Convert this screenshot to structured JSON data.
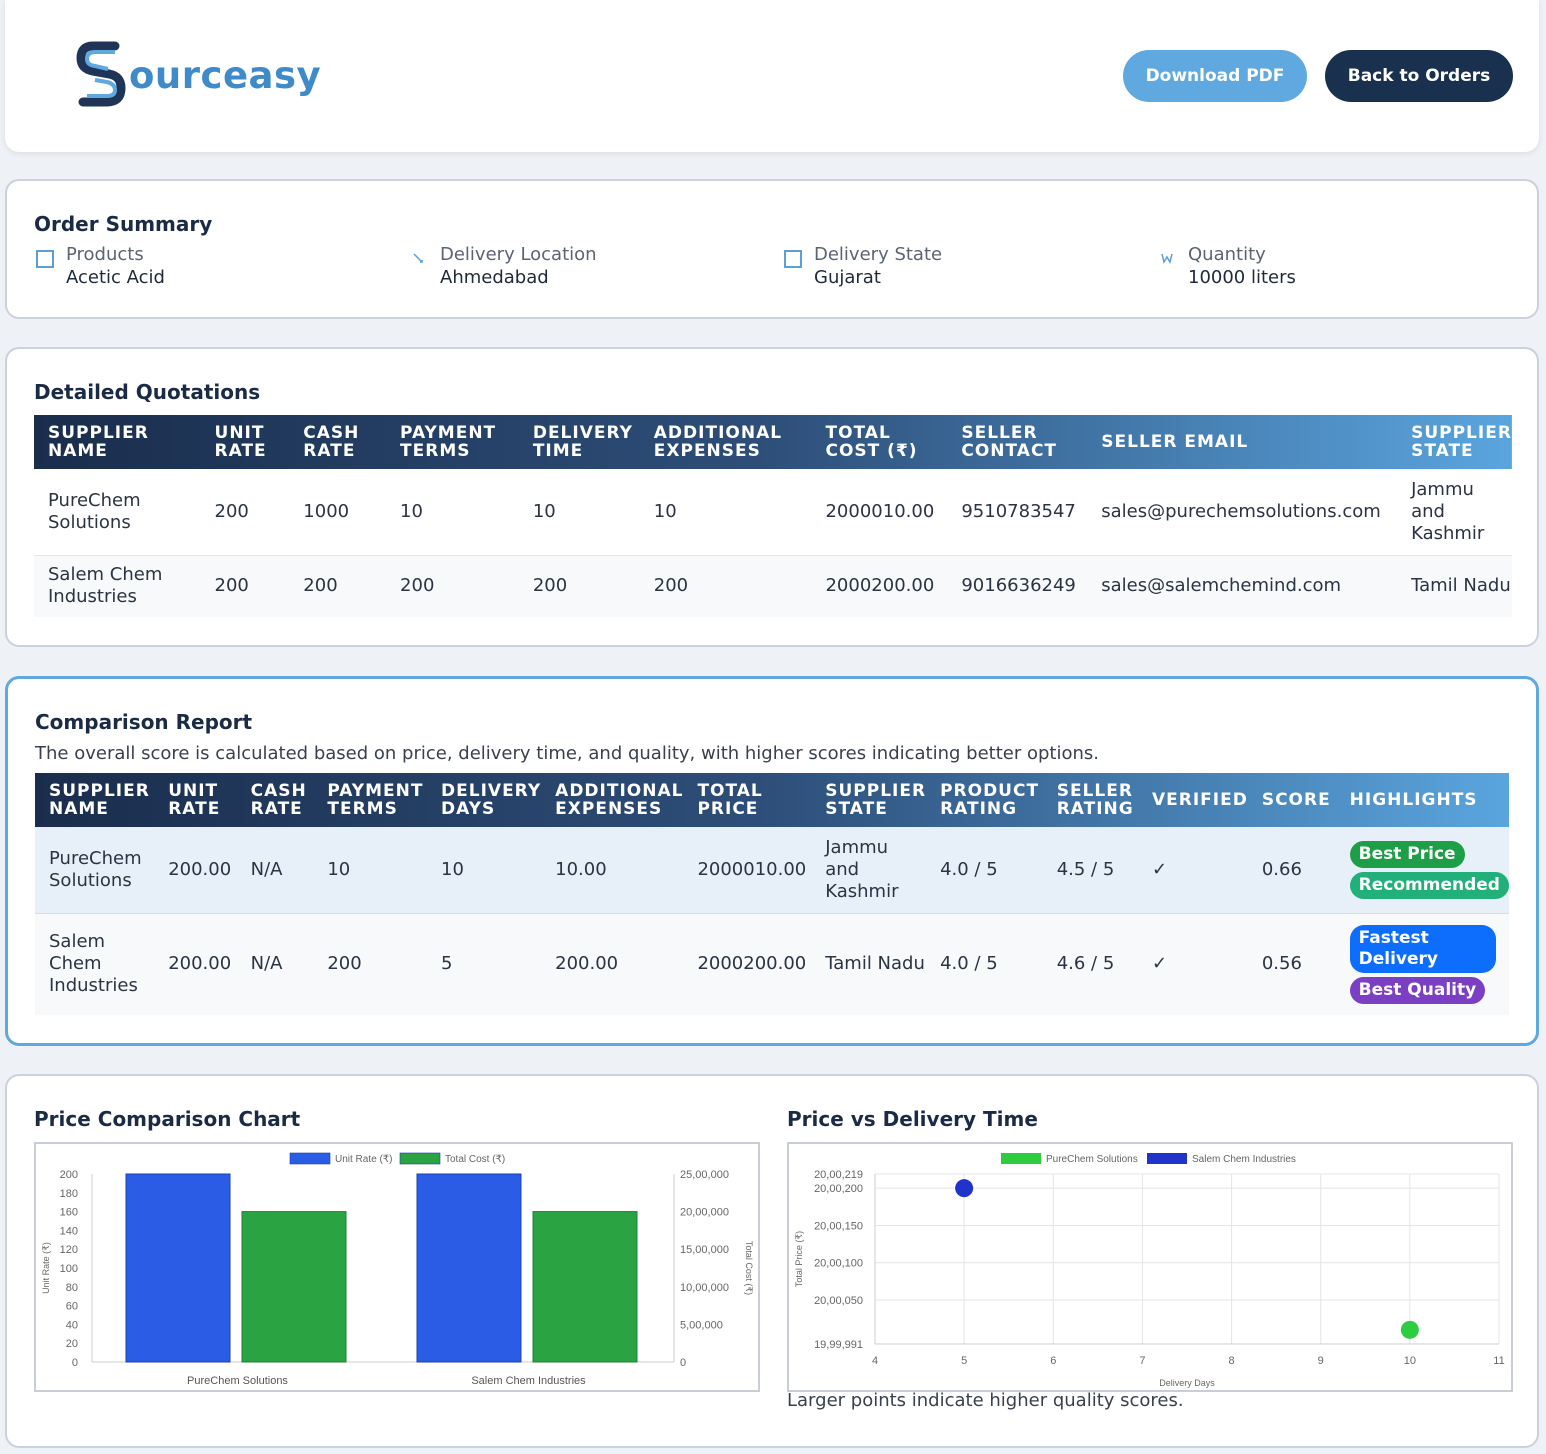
{
  "header": {
    "brand": "ourceasy",
    "download_label": "Download PDF",
    "back_label": "Back to Orders"
  },
  "summary": {
    "title": "Order Summary",
    "items": [
      {
        "label": "Products",
        "value": "Acetic Acid",
        "icon": "box-icon"
      },
      {
        "label": "Delivery Location",
        "value": "Ahmedabad",
        "icon": "location-icon"
      },
      {
        "label": "Delivery State",
        "value": "Gujarat",
        "icon": "map-icon"
      },
      {
        "label": "Quantity",
        "value": "10000 liters",
        "icon": "weight-icon"
      }
    ]
  },
  "quotations": {
    "title": "Detailed Quotations",
    "headers": [
      "SUPPLIER NAME",
      "UNIT RATE",
      "CASH RATE",
      "PAYMENT TERMS",
      "DELIVERY TIME",
      "ADDITIONAL EXPENSES",
      "TOTAL COST (₹)",
      "SELLER CONTACT",
      "SELLER EMAIL",
      "SUPPLIER STATE"
    ],
    "rows": [
      [
        "PureChem Solutions",
        "200",
        "1000",
        "10",
        "10",
        "10",
        "2000010.00",
        "9510783547",
        "sales@purechemsolutions.com",
        "Jammu and Kashmir"
      ],
      [
        "Salem Chem Industries",
        "200",
        "200",
        "200",
        "200",
        "200",
        "2000200.00",
        "9016636249",
        "sales@salemchemind.com",
        "Tamil Nadu"
      ]
    ]
  },
  "comparison": {
    "title": "Comparison Report",
    "note": "The overall score is calculated based on price, delivery time, and quality, with higher scores indicating better options.",
    "headers": [
      "SUPPLIER NAME",
      "UNIT RATE",
      "CASH RATE",
      "PAYMENT TERMS",
      "DELIVERY DAYS",
      "ADDITIONAL EXPENSES",
      "TOTAL PRICE",
      "SUPPLIER STATE",
      "PRODUCT RATING",
      "SELLER RATING",
      "VERIFIED",
      "SCORE",
      "HIGHLIGHTS"
    ],
    "rows": [
      [
        "PureChem Solutions",
        "200.00",
        "N/A",
        "10",
        "10",
        "10.00",
        "2000010.00",
        "Jammu and Kashmir",
        "4.0 / 5",
        "4.5 / 5",
        "✓",
        "0.66"
      ],
      [
        "Salem Chem Industries",
        "200.00",
        "N/A",
        "200",
        "5",
        "200.00",
        "2000200.00",
        "Tamil Nadu",
        "4.0 / 5",
        "4.6 / 5",
        "✓",
        "0.56"
      ]
    ],
    "highlights": [
      [
        {
          "label": "Best Price",
          "color": "#1e9e47"
        },
        {
          "label": "Recommended",
          "color": "#22b07a"
        }
      ],
      [
        {
          "label": "Fastest Delivery",
          "color": "#0d6efd"
        },
        {
          "label": "Best Quality",
          "color": "#7b3fc4"
        }
      ]
    ]
  },
  "charts": {
    "bar_title": "Price Comparison Chart",
    "scatter_title": "Price vs Delivery Time",
    "scatter_note": "Larger points indicate higher quality scores."
  },
  "chart_data": [
    {
      "type": "bar",
      "categories": [
        "PureChem Solutions",
        "Salem Chem Industries"
      ],
      "series": [
        {
          "name": "Unit Rate (₹)",
          "values": [
            200,
            200
          ],
          "color": "#2b5ce6",
          "axis": "left"
        },
        {
          "name": "Total Cost (₹)",
          "values": [
            2000010,
            2000200
          ],
          "color": "#2aa443",
          "axis": "right"
        }
      ],
      "ylabel": "Unit Rate (₹)",
      "y2label": "Total Cost (₹)",
      "ylim": [
        0,
        200
      ],
      "yticks": [
        "0",
        "20",
        "40",
        "60",
        "80",
        "100",
        "120",
        "140",
        "160",
        "180",
        "200"
      ],
      "y2lim": [
        0,
        2500000
      ],
      "y2ticks": [
        "0",
        "5,00,000",
        "10,00,000",
        "15,00,000",
        "20,00,000",
        "25,00,000"
      ],
      "legend": "top-center",
      "grid": false
    },
    {
      "type": "scatter",
      "series": [
        {
          "name": "PureChem Solutions",
          "color": "#2ecc40",
          "points": [
            {
              "x": 10,
              "y": 2000010
            }
          ]
        },
        {
          "name": "Salem Chem Industries",
          "color": "#2233cc",
          "points": [
            {
              "x": 5,
              "y": 2000200
            }
          ]
        }
      ],
      "xlabel": "Delivery Days",
      "ylabel": "Total Price (₹)",
      "xlim": [
        4,
        11
      ],
      "xticks": [
        "4",
        "5",
        "6",
        "7",
        "8",
        "9",
        "10",
        "11"
      ],
      "ylim": [
        1999991,
        2000219
      ],
      "yticks": [
        {
          "v": 1999991,
          "label": "19,99,991"
        },
        {
          "v": 2000050,
          "label": "20,00,050"
        },
        {
          "v": 2000100,
          "label": "20,00,100"
        },
        {
          "v": 2000150,
          "label": "20,00,150"
        },
        {
          "v": 2000200,
          "label": "20,00,200"
        },
        {
          "v": 2000219,
          "label": "20,00,219"
        }
      ],
      "legend": "top-center",
      "grid": true
    }
  ]
}
